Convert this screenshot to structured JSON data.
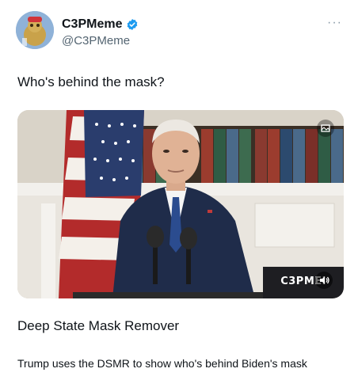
{
  "author": {
    "display_name": "C3PMeme",
    "handle": "@C3PMeme",
    "verified": true,
    "avatar": "avatar-image"
  },
  "menu": {
    "more_label": "···"
  },
  "tweet": {
    "text": "Who's behind the mask?"
  },
  "media": {
    "watermark": "C3PMEI",
    "sound_icon": "speaker-icon",
    "gallery_icon": "media-icon"
  },
  "card": {
    "title": "Deep State Mask Remover",
    "description": "Trump uses the DSMR to show who's behind Biden's mask"
  },
  "colors": {
    "text": "#0f1419",
    "secondary_text": "#536471",
    "verified_blue": "#1d9bf0"
  }
}
